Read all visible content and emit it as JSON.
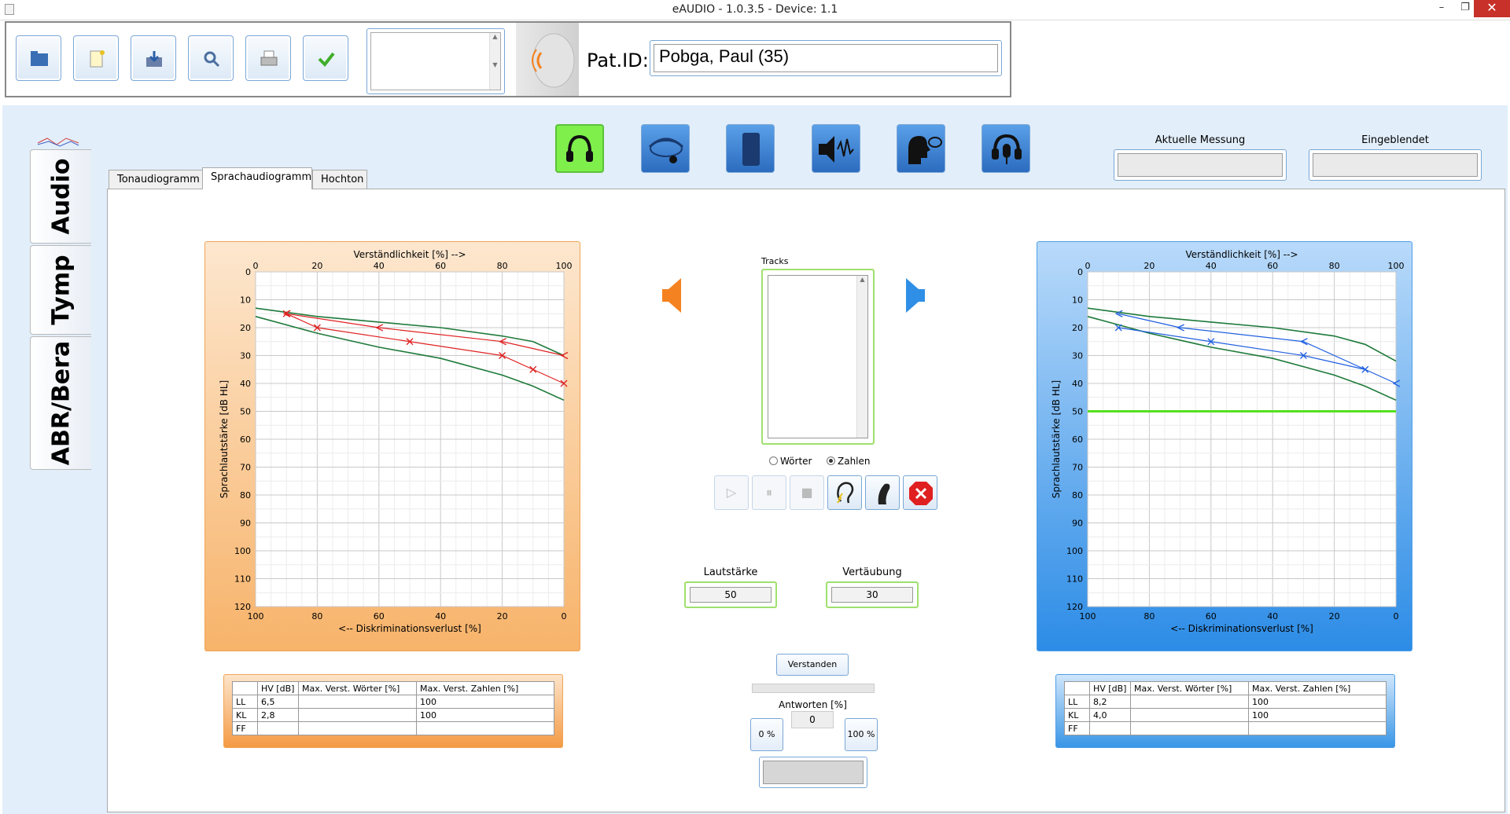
{
  "window": {
    "title": "eAUDIO - 1.0.3.5 - Device: 1.1",
    "minimize": "–",
    "restore": "❐",
    "close": "✕"
  },
  "toolbar": {
    "buttons": [
      "open",
      "new",
      "save",
      "search",
      "print",
      "confirm"
    ],
    "patient_label": "Pat.ID:",
    "patient_value": "Pobga, Paul (35)"
  },
  "side_tabs": [
    "Audio",
    "Tymp",
    "ABR/Bera"
  ],
  "mode_buttons": [
    "headphones-icon",
    "bone-conductor-icon",
    "hearing-aid-icon",
    "loudspeaker-icon",
    "speech-icon",
    "microphone-headset-icon"
  ],
  "status": {
    "current_label": "Aktuelle Messung",
    "shown_label": "Eingeblendet"
  },
  "tabs": [
    "Tonaudiogramm",
    "Sprachaudiogramm",
    "Hochton"
  ],
  "selected_tab": "Sprachaudiogramm",
  "center": {
    "tracks_label": "Tracks",
    "radio_words": "Wörter",
    "radio_numbers": "Zahlen",
    "selected_radio": "Zahlen",
    "volume_label": "Lautstärke",
    "volume_value": "50",
    "masking_label": "Vertäubung",
    "masking_value": "30",
    "understood_label": "Verstanden",
    "answers_label": "Antworten [%]",
    "answers_value": "0",
    "btn_zero": "0 %",
    "btn_hundred": "100 %"
  },
  "colors": {
    "left_ear": "#f58220",
    "right_ear": "#2f8fe6",
    "active_mode": "#7fef4c"
  },
  "chart_data": [
    {
      "type": "line",
      "ear": "left",
      "top_axis_label": "Verständlichkeit [%] -->",
      "bottom_axis_label": "<-- Diskriminationsverlust [%]",
      "ylabel": "Sprachlautstärke [dB HL]",
      "top_ticks": [
        "0",
        "20",
        "40",
        "60",
        "80",
        "100"
      ],
      "bottom_ticks": [
        "100",
        "80",
        "60",
        "40",
        "20",
        "0"
      ],
      "y_ticks": [
        "0",
        "10",
        "20",
        "30",
        "40",
        "50",
        "60",
        "70",
        "80",
        "90",
        "100",
        "110",
        "120"
      ],
      "xlim": [
        0,
        100
      ],
      "ylim": [
        0,
        120
      ],
      "series": [
        {
          "role": "norm-upper",
          "color": "#1e7a3a",
          "x": [
            0,
            20,
            40,
            60,
            80,
            90,
            100
          ],
          "y": [
            13,
            16,
            18,
            20,
            23,
            25,
            30
          ]
        },
        {
          "role": "norm-lower",
          "color": "#1e7a3a",
          "x": [
            0,
            20,
            40,
            60,
            80,
            90,
            100
          ],
          "y": [
            16,
            22,
            27,
            31,
            37,
            41,
            46
          ]
        },
        {
          "role": "measurement",
          "marker": "<",
          "color": "#e02020",
          "x": [
            10,
            40,
            80,
            100
          ],
          "y": [
            15,
            20,
            25,
            30
          ]
        },
        {
          "role": "measurement",
          "marker": "x",
          "color": "#e02020",
          "x": [
            10,
            20,
            50,
            80,
            90,
            100
          ],
          "y": [
            15,
            20,
            25,
            30,
            35,
            40
          ]
        }
      ]
    },
    {
      "type": "line",
      "ear": "right",
      "top_axis_label": "Verständlichkeit [%] -->",
      "bottom_axis_label": "<-- Diskriminationsverlust [%]",
      "ylabel": "Sprachlautstärke [dB HL]",
      "top_ticks": [
        "0",
        "20",
        "40",
        "60",
        "80",
        "100"
      ],
      "bottom_ticks": [
        "100",
        "80",
        "60",
        "40",
        "20",
        "0"
      ],
      "y_ticks": [
        "0",
        "10",
        "20",
        "30",
        "40",
        "50",
        "60",
        "70",
        "80",
        "90",
        "100",
        "110",
        "120"
      ],
      "xlim": [
        0,
        100
      ],
      "ylim": [
        0,
        120
      ],
      "hline": {
        "y": 50,
        "color": "#55e020"
      },
      "series": [
        {
          "role": "norm-upper",
          "color": "#1e7a3a",
          "x": [
            0,
            20,
            40,
            60,
            80,
            90,
            100
          ],
          "y": [
            13,
            16,
            18,
            20,
            23,
            26,
            32
          ]
        },
        {
          "role": "norm-lower",
          "color": "#1e7a3a",
          "x": [
            0,
            20,
            40,
            60,
            80,
            90,
            100
          ],
          "y": [
            16,
            22,
            27,
            31,
            37,
            41,
            46
          ]
        },
        {
          "role": "measurement",
          "marker": "<",
          "color": "#2060e0",
          "x": [
            10,
            30,
            70,
            100
          ],
          "y": [
            15,
            20,
            25,
            40
          ]
        },
        {
          "role": "measurement",
          "marker": "x",
          "color": "#2060e0",
          "x": [
            10,
            40,
            70,
            90
          ],
          "y": [
            20,
            25,
            30,
            35
          ]
        }
      ]
    }
  ],
  "results": {
    "headers": [
      "",
      "HV [dB]",
      "Max. Verst. Wörter [%]",
      "Max. Verst. Zahlen [%]"
    ],
    "left_rows": [
      [
        "LL",
        "6,5",
        "",
        "100"
      ],
      [
        "KL",
        "2,8",
        "",
        "100"
      ],
      [
        "FF",
        "",
        "",
        ""
      ]
    ],
    "right_rows": [
      [
        "LL",
        "8,2",
        "",
        "100"
      ],
      [
        "KL",
        "4,0",
        "",
        "100"
      ],
      [
        "FF",
        "",
        "",
        ""
      ]
    ]
  }
}
